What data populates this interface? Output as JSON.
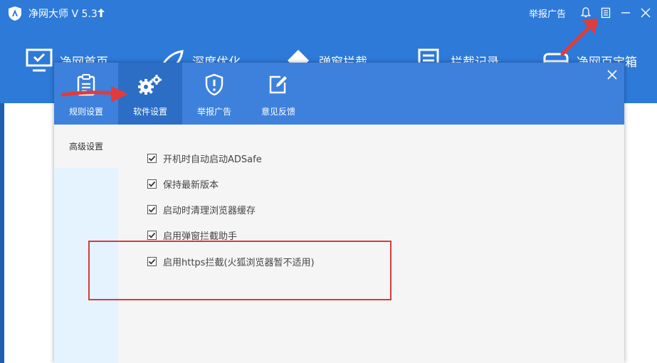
{
  "app": {
    "title": "净网大师 V 5.3",
    "report_link": "举报广告",
    "icons": [
      "bell-icon",
      "document-icon",
      "minimize-icon",
      "close-icon"
    ]
  },
  "background_nav": [
    {
      "label": "净网首页",
      "icon": "monitor-icon"
    },
    {
      "label": "深度优化",
      "icon": "rocket-icon"
    },
    {
      "label": "弹窗拦截",
      "icon": "diamond-icon"
    },
    {
      "label": "拦截记录",
      "icon": "record-icon"
    },
    {
      "label": "净网百宝箱",
      "icon": "box-icon"
    }
  ],
  "dialog": {
    "tabs": [
      {
        "label": "规则设置",
        "icon": "clipboard-icon"
      },
      {
        "label": "软件设置",
        "icon": "gears-icon"
      },
      {
        "label": "举报广告",
        "icon": "shield-alert-icon"
      },
      {
        "label": "意见反馈",
        "icon": "edit-icon"
      }
    ],
    "active_tab": "软件设置",
    "side_item": "高级设置",
    "options": [
      {
        "label": "开机时自动启动ADSafe",
        "checked": true
      },
      {
        "label": "保持最新版本",
        "checked": true
      },
      {
        "label": "启动时清理浏览器缓存",
        "checked": true
      },
      {
        "label": "启用弹窗拦截助手",
        "checked": true
      },
      {
        "label": "启用https拦截(火狐浏览器暂不适用)",
        "checked": true
      }
    ]
  },
  "colors": {
    "titlebar": "#2d7ad9",
    "dialog_header": "#3e81dc",
    "active_tab": "#2c6ec5",
    "highlight": "#d93a3a"
  }
}
